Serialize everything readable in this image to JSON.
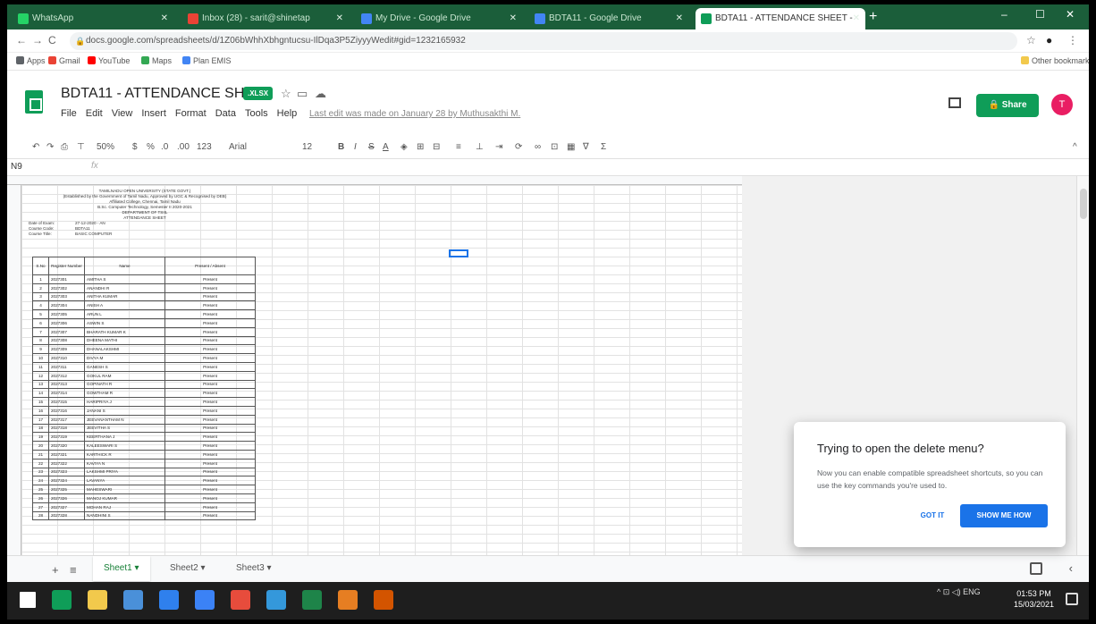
{
  "browser": {
    "tabs": [
      {
        "label": "WhatsApp",
        "color": "#25d366"
      },
      {
        "label": "Inbox (28) - sarit@shinetap",
        "color": "#ea4335"
      },
      {
        "label": "My Drive - Google Drive",
        "color": "#4285f4"
      },
      {
        "label": "BDTA11 - Google Drive",
        "color": "#4285f4"
      },
      {
        "label": "BDTA11 - ATTENDANCE SHEET - ",
        "color": "#0f9d58"
      }
    ],
    "new_tab": "+",
    "window_controls": [
      "–",
      "☐",
      "✕"
    ],
    "url": "docs.google.com/spreadsheets/d/1Z06bWhhXbhgntucsu-IlDqa3P5ZiyyyWedit#gid=1232165932",
    "bookmarks": [
      {
        "label": "Apps",
        "color": "#5f6368"
      },
      {
        "label": "Gmail",
        "color": "#ea4335"
      },
      {
        "label": "YouTube",
        "color": "#ff0000"
      },
      {
        "label": "Maps",
        "color": "#34a853"
      },
      {
        "label": "Plan EMIS",
        "color": "#4285f4"
      }
    ],
    "other_bookmarks": "Other bookmarks"
  },
  "doc": {
    "title": "BDTA11 - ATTENDANCE SHEET",
    "badge": ".XLSX",
    "menus": [
      "File",
      "Edit",
      "View",
      "Insert",
      "Format",
      "Data",
      "Tools",
      "Help"
    ],
    "last_edit": "Last edit was made on January 28 by Muthusakthi M.",
    "share": "Share",
    "avatar": "T"
  },
  "toolbar": {
    "zoom": "50%",
    "format": "123",
    "font": "Arial",
    "size": "12"
  },
  "formula": {
    "cell": "N9",
    "fx": "fx"
  },
  "sheet": {
    "header_lines": [
      "TAMILNADU OPEN UNIVERSITY (STATE GOVT.)",
      "(Established by the Government of Tamil Nadu, Approved by UGC & Recognised by DEB)",
      "Affiliated College, Chennai, Tamil Nadu",
      "B.Sc. Computer Technology, Semester II 2020-2021",
      "DEPARTMENT OF TSIIL",
      "ATTENDANCE SHEET"
    ],
    "info": [
      {
        "k": "Date of Exam:",
        "v": "27-12-2020 - AN"
      },
      {
        "k": "Course Code:",
        "v": "BDTA11"
      },
      {
        "k": "Course Title:",
        "v": "BASIC COMPUTER"
      }
    ],
    "col_headers": [
      "S.No",
      "Register Number",
      "Name",
      "Present / Absent"
    ],
    "rows": [
      {
        "n": "1",
        "reg": "2027301",
        "name": "AMITHA S",
        "st": "Present"
      },
      {
        "n": "2",
        "reg": "2027302",
        "name": "ANANDHI R",
        "st": "Present"
      },
      {
        "n": "3",
        "reg": "2027303",
        "name": "ANITHA KUMAR",
        "st": "Present"
      },
      {
        "n": "4",
        "reg": "2027304",
        "name": "ANISH A",
        "st": "Present"
      },
      {
        "n": "5",
        "reg": "2027305",
        "name": "ARUN L",
        "st": "Present"
      },
      {
        "n": "6",
        "reg": "2027306",
        "name": "ASWIN S",
        "st": "Present"
      },
      {
        "n": "7",
        "reg": "2027307",
        "name": "BHARATH KUMAR K",
        "st": "Present"
      },
      {
        "n": "8",
        "reg": "2027308",
        "name": "DHEENA MATHI",
        "st": "Present"
      },
      {
        "n": "9",
        "reg": "2027309",
        "name": "DHANALAKSHMI",
        "st": "Present"
      },
      {
        "n": "10",
        "reg": "2027310",
        "name": "DIVYA M",
        "st": "Present"
      },
      {
        "n": "11",
        "reg": "2027311",
        "name": "GANESH S",
        "st": "Present"
      },
      {
        "n": "12",
        "reg": "2027312",
        "name": "GOKUL RAM",
        "st": "Present"
      },
      {
        "n": "13",
        "reg": "2027313",
        "name": "GOPINATH R",
        "st": "Present"
      },
      {
        "n": "14",
        "reg": "2027314",
        "name": "GOWTHAM R",
        "st": "Present"
      },
      {
        "n": "15",
        "reg": "2027315",
        "name": "HARIPRIYA J",
        "st": "Present"
      },
      {
        "n": "16",
        "reg": "2027316",
        "name": "JANANI S",
        "st": "Present"
      },
      {
        "n": "17",
        "reg": "2027317",
        "name": "JEEVANANTHAM N",
        "st": "Present"
      },
      {
        "n": "18",
        "reg": "2027318",
        "name": "JEEVITHA S",
        "st": "Present"
      },
      {
        "n": "19",
        "reg": "2027319",
        "name": "KEERTHANA J",
        "st": "Present"
      },
      {
        "n": "20",
        "reg": "2027320",
        "name": "KALEESWARI S",
        "st": "Present"
      },
      {
        "n": "21",
        "reg": "2027321",
        "name": "KARTHICK R",
        "st": "Present"
      },
      {
        "n": "22",
        "reg": "2027322",
        "name": "KAVIYA N",
        "st": "Present"
      },
      {
        "n": "23",
        "reg": "2027323",
        "name": "LAKSHMI PRIYA",
        "st": "Present"
      },
      {
        "n": "24",
        "reg": "2027324",
        "name": "LAVANYA",
        "st": "Present"
      },
      {
        "n": "25",
        "reg": "2027325",
        "name": "MAHESWARI",
        "st": "Present"
      },
      {
        "n": "26",
        "reg": "2027326",
        "name": "MANOJ KUMAR",
        "st": "Present"
      },
      {
        "n": "27",
        "reg": "2027327",
        "name": "MOHAN RAJ",
        "st": "Present"
      },
      {
        "n": "28",
        "reg": "2027328",
        "name": "NANDHINI S",
        "st": "Present"
      }
    ]
  },
  "sheets": [
    "Sheet1",
    "Sheet2",
    "Sheet3"
  ],
  "dialog": {
    "title": "Trying to open the delete menu?",
    "body": "Now you can enable compatible spreadsheet shortcuts, so you can use the key commands you're used to.",
    "got_it": "GOT IT",
    "show_me": "SHOW ME HOW"
  },
  "taskbar": {
    "apps": [
      {
        "name": "windows-start",
        "color": "#ffffff"
      },
      {
        "name": "sheets-app",
        "color": "#0f9d58"
      },
      {
        "name": "file-explorer",
        "color": "#f2c94c"
      },
      {
        "name": "app-blue",
        "color": "#4a90d9"
      },
      {
        "name": "chat-app",
        "color": "#2f80ed"
      },
      {
        "name": "calendar-app",
        "color": "#3b82f6"
      },
      {
        "name": "paint-app",
        "color": "#e74c3c"
      },
      {
        "name": "photos-app",
        "color": "#3498db"
      },
      {
        "name": "excel-app",
        "color": "#1e8449"
      },
      {
        "name": "firefox-app",
        "color": "#e67e22"
      },
      {
        "name": "office-app",
        "color": "#d35400"
      }
    ],
    "tray": "^  ⊡  ◁)  ENG",
    "time": "01:53 PM",
    "date": "15/03/2021"
  }
}
